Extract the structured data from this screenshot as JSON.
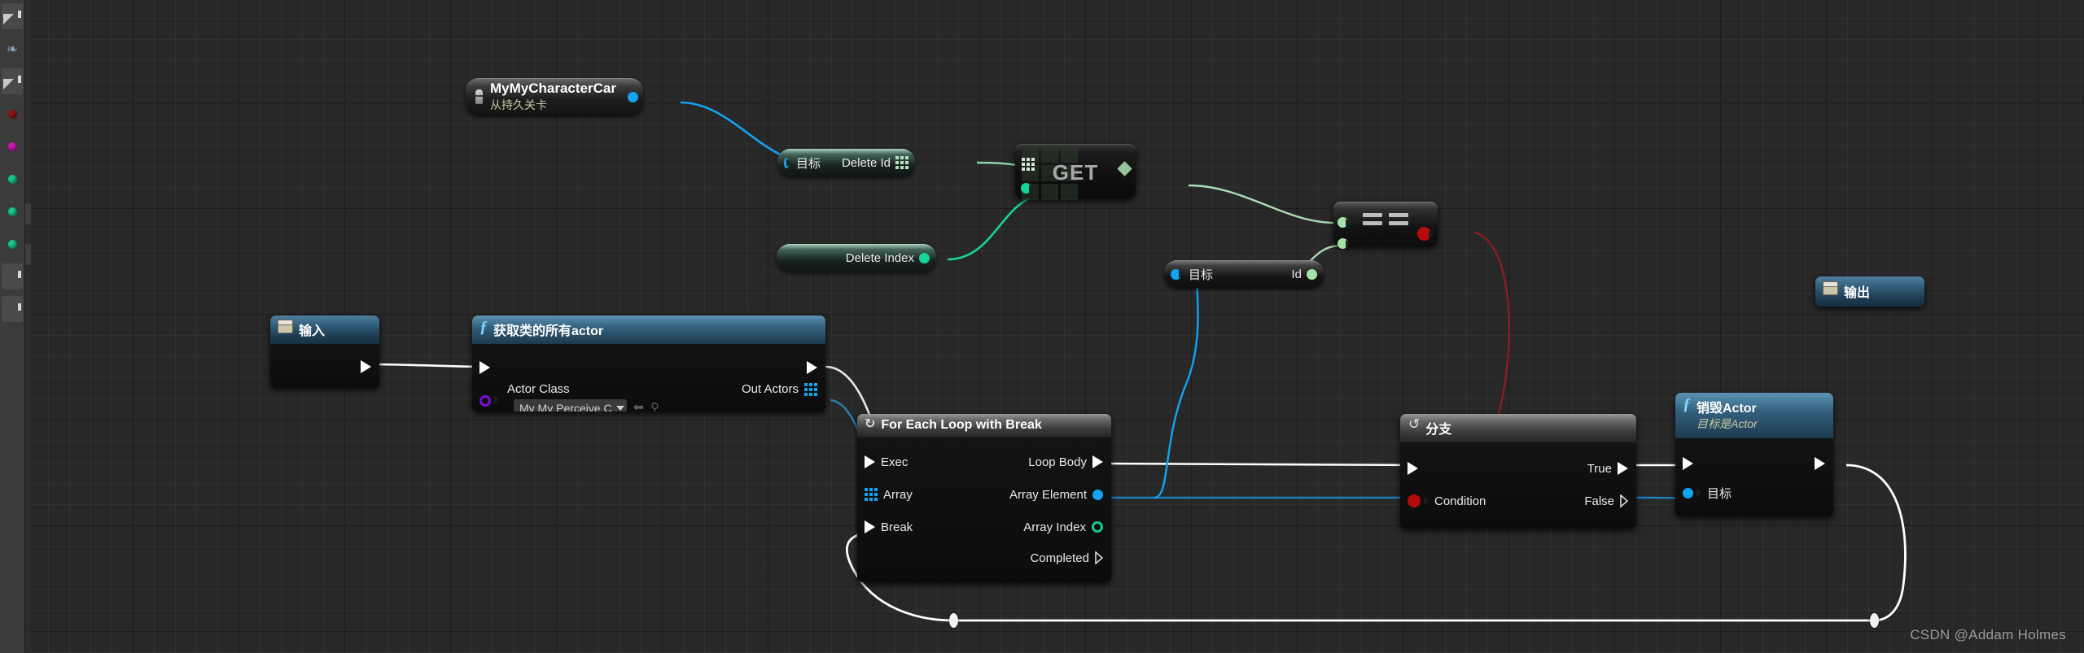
{
  "watermark": "CSDN @Addam Holmes",
  "toolstrip": {
    "items": [
      {
        "name": "resize-handle-top",
        "kind": "triangle"
      },
      {
        "name": "puzzle-plugin-icon",
        "kind": "puzzle",
        "glyph": "❇"
      },
      {
        "name": "resize-handle",
        "kind": "triangle"
      },
      {
        "name": "palette-dot-red",
        "kind": "dot",
        "color": "#8c1414"
      },
      {
        "name": "palette-dot-magenta",
        "kind": "dot",
        "color": "#c91bb5"
      },
      {
        "name": "palette-dot-green-1",
        "kind": "dot",
        "color": "#16c98d"
      },
      {
        "name": "palette-dot-green-2",
        "kind": "dot",
        "color": "#16c98d"
      },
      {
        "name": "palette-dot-green-3",
        "kind": "dot",
        "color": "#16c98d"
      },
      {
        "name": "palette-slot-1",
        "kind": "slot"
      },
      {
        "name": "palette-slot-2",
        "kind": "slot"
      }
    ]
  },
  "nodes": {
    "mychar": {
      "title": "MyMyCharacterCar",
      "subtitle": "从持久关卡",
      "icon": "person-icon"
    },
    "delete_id": {
      "target_label": "目标",
      "out_label": "Delete Id"
    },
    "delete_index": {
      "label": "Delete Index"
    },
    "get": {
      "label": "GET"
    },
    "equals": {
      "label": "=="
    },
    "target_id": {
      "target_label": "目标",
      "out_label": "Id"
    },
    "input": {
      "title": "输入"
    },
    "output": {
      "title": "输出"
    },
    "get_all_actors": {
      "title": "获取类的所有actor",
      "in_exec": "",
      "actor_class_label": "Actor Class",
      "actor_class_value": "My My Perceive C",
      "out_actors_label": "Out Actors"
    },
    "for_each_loop": {
      "title": "For Each Loop with Break",
      "in": [
        "Exec",
        "Array",
        "Break"
      ],
      "out": [
        "Loop Body",
        "Array Element",
        "Array Index",
        "Completed"
      ]
    },
    "branch": {
      "title": "分支",
      "condition_label": "Condition",
      "true_label": "True",
      "false_label": "False"
    },
    "destroy_actor": {
      "title": "销毁Actor",
      "subtitle": "目标是Actor",
      "target_label": "目标"
    }
  },
  "colors": {
    "exec_white": "#ffffff",
    "object_blue": "#12a4f0",
    "int_teal": "#16d39a",
    "string_pale_green": "#a5e3a8",
    "bool_red": "#b50b0b",
    "class_purple": "#7b0ed2",
    "array_blue": "#12a4f0"
  }
}
